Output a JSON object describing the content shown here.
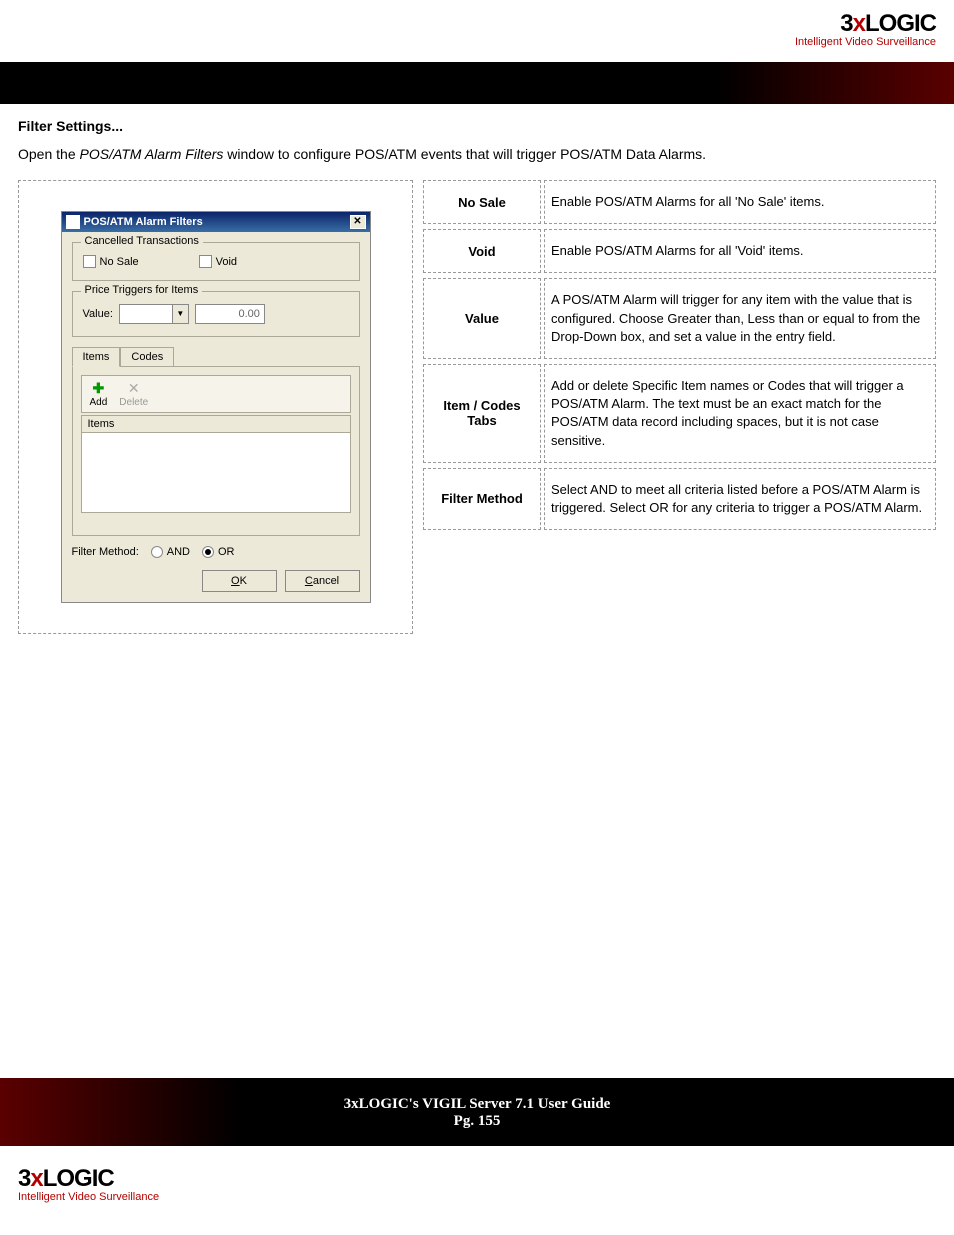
{
  "brand": {
    "name_part1": "3",
    "name_x": "x",
    "name_part2": "LOGIC",
    "tagline": "Intelligent Video Surveillance"
  },
  "section": {
    "title": "Filter Settings...",
    "intro_pre": "Open the ",
    "intro_italic": "POS/ATM Alarm Filters",
    "intro_post": " window to configure POS/ATM events that will trigger POS/ATM Data Alarms."
  },
  "dialog": {
    "title": "POS/ATM Alarm Filters",
    "cancelled_legend": "Cancelled Transactions",
    "no_sale_label": "No Sale",
    "void_label": "Void",
    "price_legend": "Price Triggers for Items",
    "value_label": "Value:",
    "num_value": "0.00",
    "tab_items": "Items",
    "tab_codes": "Codes",
    "add_label": "Add",
    "delete_label": "Delete",
    "items_header": "Items",
    "filter_method_label": "Filter Method:",
    "and_label": "AND",
    "or_label": "OR",
    "ok_label": "OK",
    "ok_underline": "O",
    "ok_rest": "K",
    "cancel_label": "Cancel",
    "cancel_underline": "C",
    "cancel_rest": "ancel"
  },
  "rows": {
    "r1_label": "No Sale",
    "r1_text": "Enable POS/ATM Alarms for all 'No Sale' items.",
    "r2_label": "Void",
    "r2_text": "Enable POS/ATM Alarms for all 'Void' items.",
    "r3_label": "Value",
    "r3_text": "A POS/ATM Alarm will trigger for any item with the value that is configured.  Choose Greater than, Less than or equal to from the Drop-Down box, and set a value in the entry field.",
    "r4_label": "Item / Codes Tabs",
    "r4_text": "Add or delete Specific Item names or Codes that will trigger a POS/ATM Alarm.  The text must be an exact match for the POS/ATM data record including spaces, but it is not case sensitive.",
    "r5_label": "Filter Method",
    "r5_text": "Select AND to meet all criteria listed before a POS/ATM Alarm is triggered.  Select OR for any criteria to trigger a POS/ATM Alarm."
  },
  "footer": {
    "guide": "3xLOGIC's VIGIL Server 7.1 User Guide",
    "page": "Pg. 155"
  }
}
